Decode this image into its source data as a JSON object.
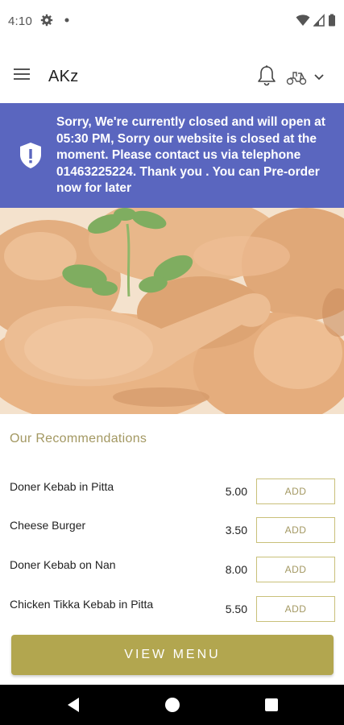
{
  "status_bar": {
    "time": "4:10",
    "icons": [
      "settings-gear-icon",
      "notification-dot-icon",
      "wifi-icon",
      "cell-signal-icon",
      "battery-icon"
    ]
  },
  "header": {
    "title": "AKz",
    "icons": [
      "hamburger-menu-icon",
      "bell-icon",
      "scooter-icon",
      "chevron-down-icon"
    ]
  },
  "notice": {
    "text": "Sorry, We're currently closed and will open at 05:30 PM, Sorry our website is closed at the moment. Please contact us via telephone 01463225224. Thank you . You can Pre-order now for later",
    "icon": "shield-alert-icon",
    "background": "#5a66bf"
  },
  "hero": {
    "image": "chicken-drumsticks-photo"
  },
  "recommendations": {
    "title": "Our Recommendations",
    "items": [
      {
        "name": "Doner Kebab in Pitta",
        "price": "5.00",
        "button": "ADD"
      },
      {
        "name": "Cheese Burger",
        "price": "3.50",
        "button": "ADD"
      },
      {
        "name": "Doner Kebab on Nan",
        "price": "8.00",
        "button": "ADD"
      },
      {
        "name": "Chicken Tikka Kebab in Pitta",
        "price": "5.50",
        "button": "ADD"
      }
    ]
  },
  "view_menu": {
    "label": "VIEW MENU",
    "color": "#b2a64f"
  },
  "accent_color": "#a39862",
  "nav_bar": {
    "icons": [
      "back-icon",
      "home-icon",
      "recent-apps-icon"
    ]
  }
}
